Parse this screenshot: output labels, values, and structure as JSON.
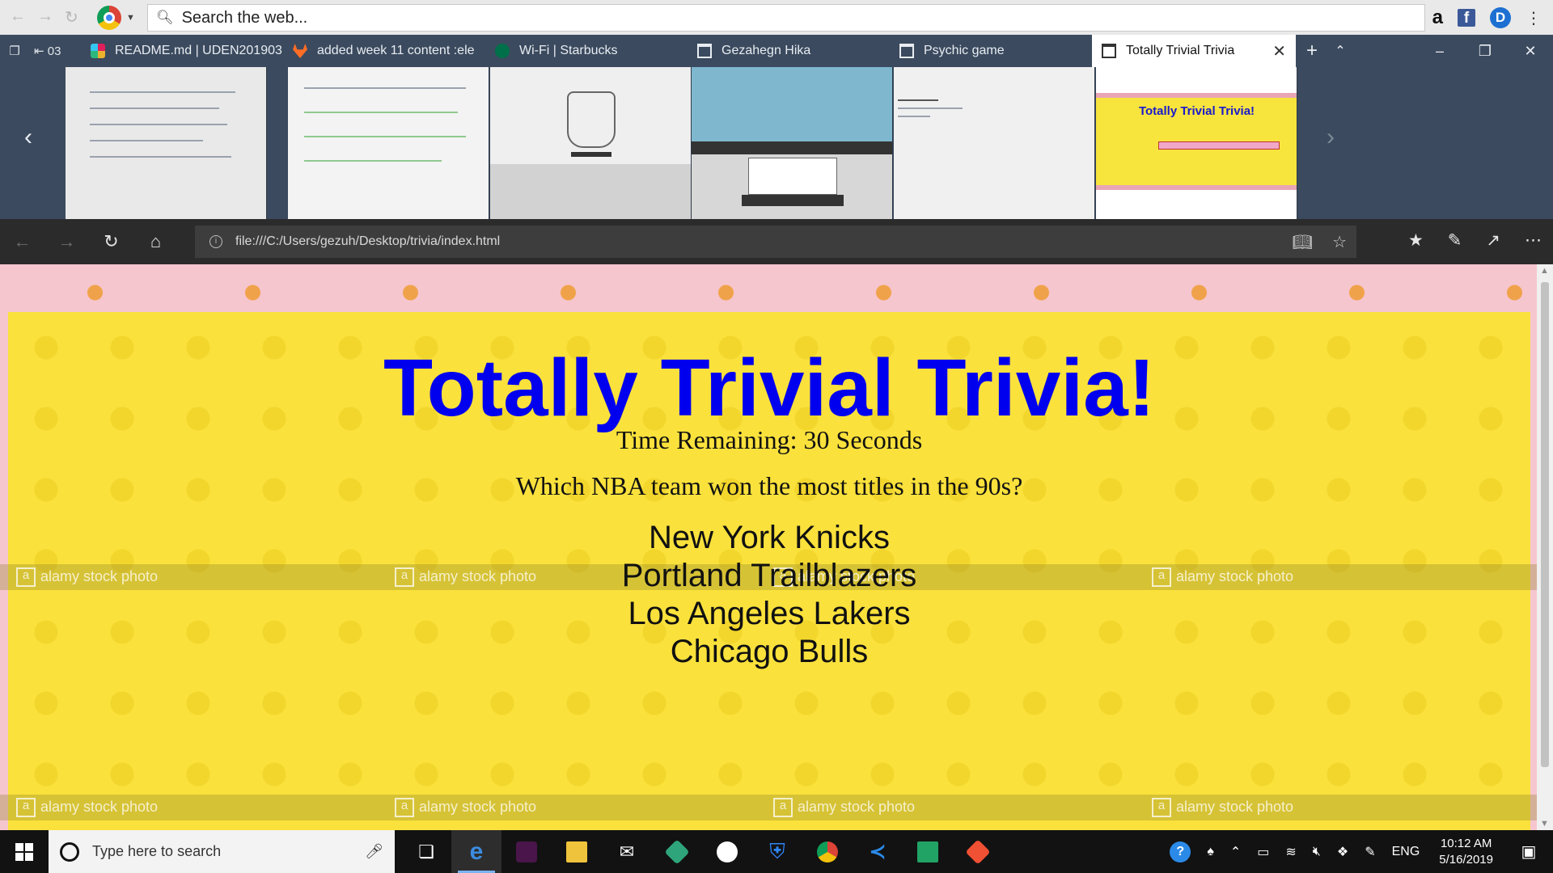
{
  "searchbar": {
    "placeholder": "Search the web..."
  },
  "tabs": {
    "partial": "03",
    "items": [
      {
        "label": "README.md | UDEN201903"
      },
      {
        "label": "added week 11 content :ele"
      },
      {
        "label": "Wi-Fi | Starbucks"
      },
      {
        "label": "Gezahegn Hika"
      },
      {
        "label": "Psychic game"
      }
    ],
    "active": {
      "label": "Totally Trivial Trivia"
    }
  },
  "previews": {
    "active_title": "Totally Trivial Trivia!"
  },
  "address": {
    "url": "file:///C:/Users/gezuh/Desktop/trivia/index.html"
  },
  "page": {
    "title": "Totally Trivial Trivia!",
    "timer_text": "Time Remaining: 30 Seconds",
    "question": "Which NBA team won the most titles in the 90s?",
    "answers": [
      "New York Knicks",
      "Portland Trailblazers",
      "Los Angeles Lakers",
      "Chicago Bulls"
    ],
    "watermark": "alamy stock photo"
  },
  "taskbar": {
    "search_placeholder": "Type here to search",
    "language": "ENG",
    "time": "10:12 AM",
    "date": "5/16/2019"
  },
  "colors": {
    "title": "#0000ee",
    "background_yellow": "#fae13c",
    "background_pink": "#f6c6cf",
    "tabstrip": "#3b4a5e"
  }
}
